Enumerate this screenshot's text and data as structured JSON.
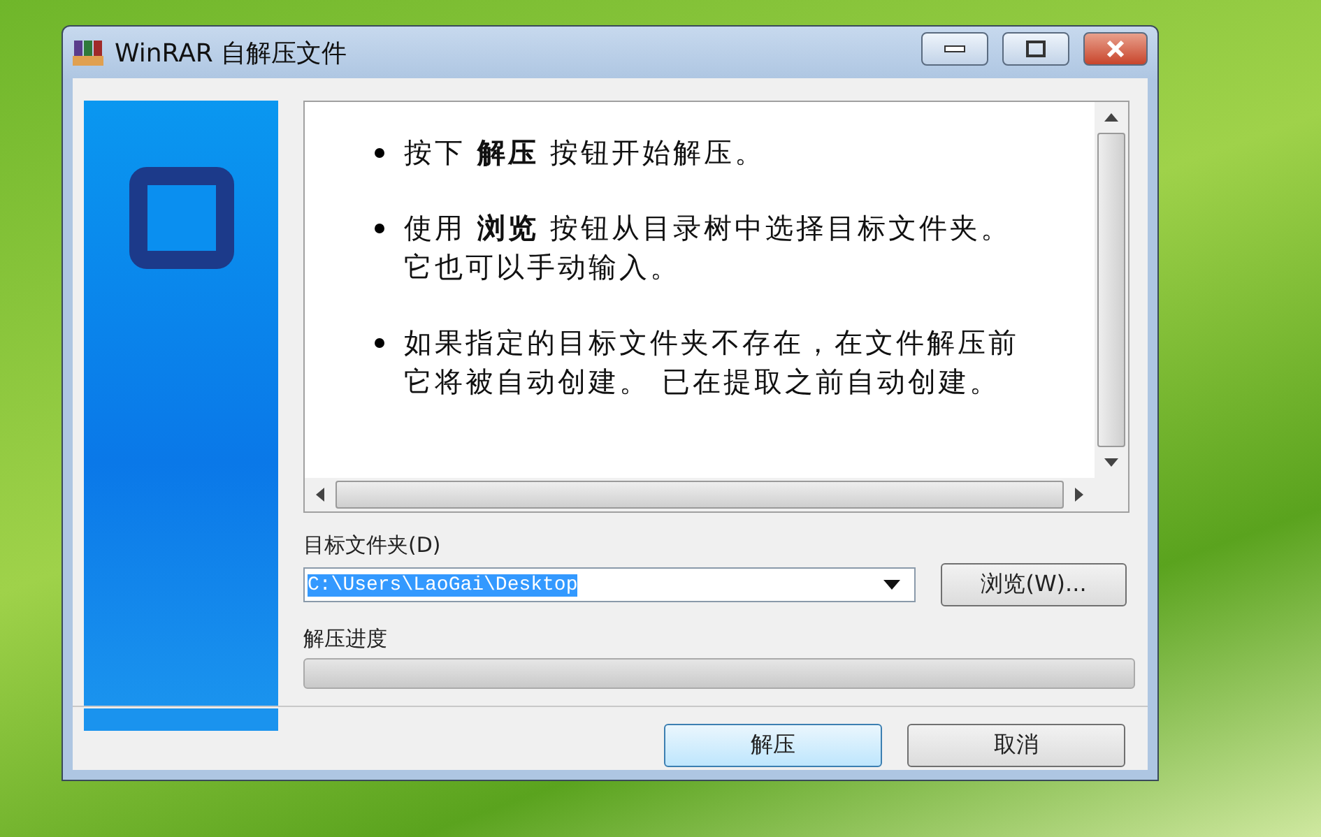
{
  "window": {
    "title": "WinRAR 自解压文件"
  },
  "info": {
    "bullets": [
      "按下 **解压** 按钮开始解压。",
      "使用 **浏览** 按钮从目录树中选择目标文件夹。它也可以手动输入。",
      "如果指定的目标文件夹不存在，在文件解压前它将被自动创建。 已在提取之前自动创建。"
    ]
  },
  "destination": {
    "label": "目标文件夹(D)",
    "value": "C:\\Users\\LaoGai\\Desktop",
    "selected": true,
    "browse_button": "浏览(W)..."
  },
  "progress": {
    "label": "解压进度",
    "level": 0
  },
  "buttons": [
    {
      "label": "解压",
      "kind": "default"
    },
    {
      "label": "取消",
      "kind": "normal"
    }
  ]
}
